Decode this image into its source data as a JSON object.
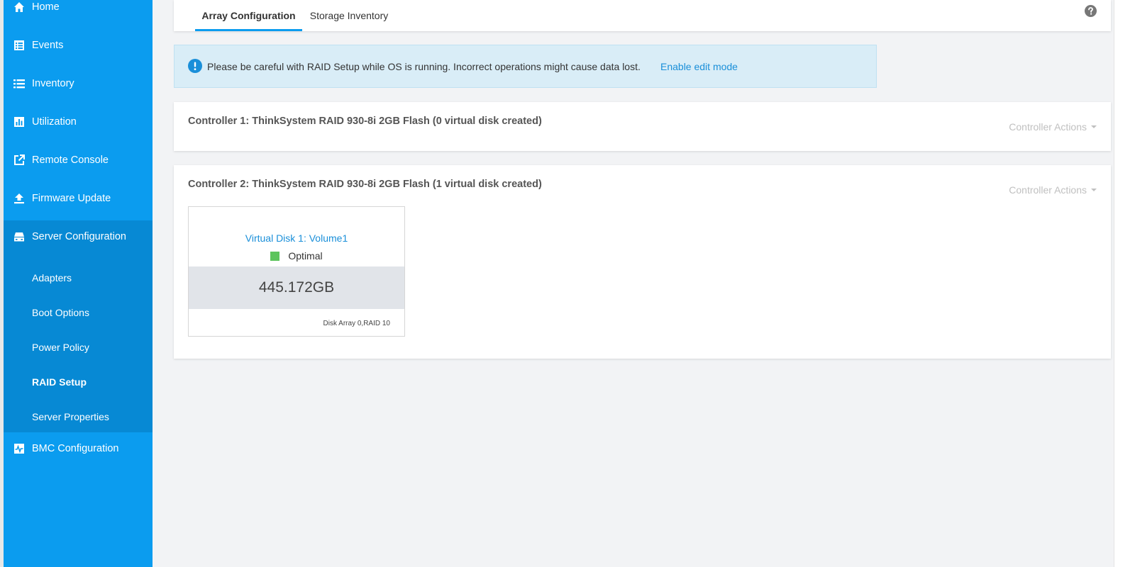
{
  "sidebar": {
    "items": [
      {
        "label": "Home",
        "icon": "home-icon"
      },
      {
        "label": "Events",
        "icon": "events-icon"
      },
      {
        "label": "Inventory",
        "icon": "list-icon"
      },
      {
        "label": "Utilization",
        "icon": "bar-chart-icon"
      },
      {
        "label": "Remote Console",
        "icon": "external-link-icon"
      },
      {
        "label": "Firmware Update",
        "icon": "upload-icon"
      },
      {
        "label": "Server Configuration",
        "icon": "server-icon"
      },
      {
        "label": "BMC Configuration",
        "icon": "pulse-icon"
      }
    ],
    "submenu": [
      {
        "label": "Adapters"
      },
      {
        "label": "Boot Options"
      },
      {
        "label": "Power Policy"
      },
      {
        "label": "RAID Setup",
        "active": true
      },
      {
        "label": "Server Properties"
      }
    ]
  },
  "tabs": [
    {
      "label": "Array Configuration",
      "active": true
    },
    {
      "label": "Storage Inventory"
    }
  ],
  "alert": {
    "message": "Please be careful with RAID Setup while OS is running. Incorrect operations might cause data lost.",
    "link": "Enable edit mode"
  },
  "controllers": [
    {
      "title": "Controller 1: ThinkSystem RAID 930-8i 2GB Flash (0 virtual disk created)",
      "actions": "Controller Actions"
    },
    {
      "title": "Controller 2: ThinkSystem RAID 930-8i 2GB Flash (1 virtual disk created)",
      "actions": "Controller Actions",
      "virtual_disk": {
        "name": "Virtual Disk 1: Volume1",
        "status": "Optimal",
        "size": "445.172GB",
        "array": "Disk Array 0,RAID 10"
      }
    }
  ],
  "colors": {
    "sidebar": "#0b9cef",
    "submenu": "#0789d4",
    "accent": "#1a8fd9",
    "status_optimal": "#5cc45c"
  }
}
